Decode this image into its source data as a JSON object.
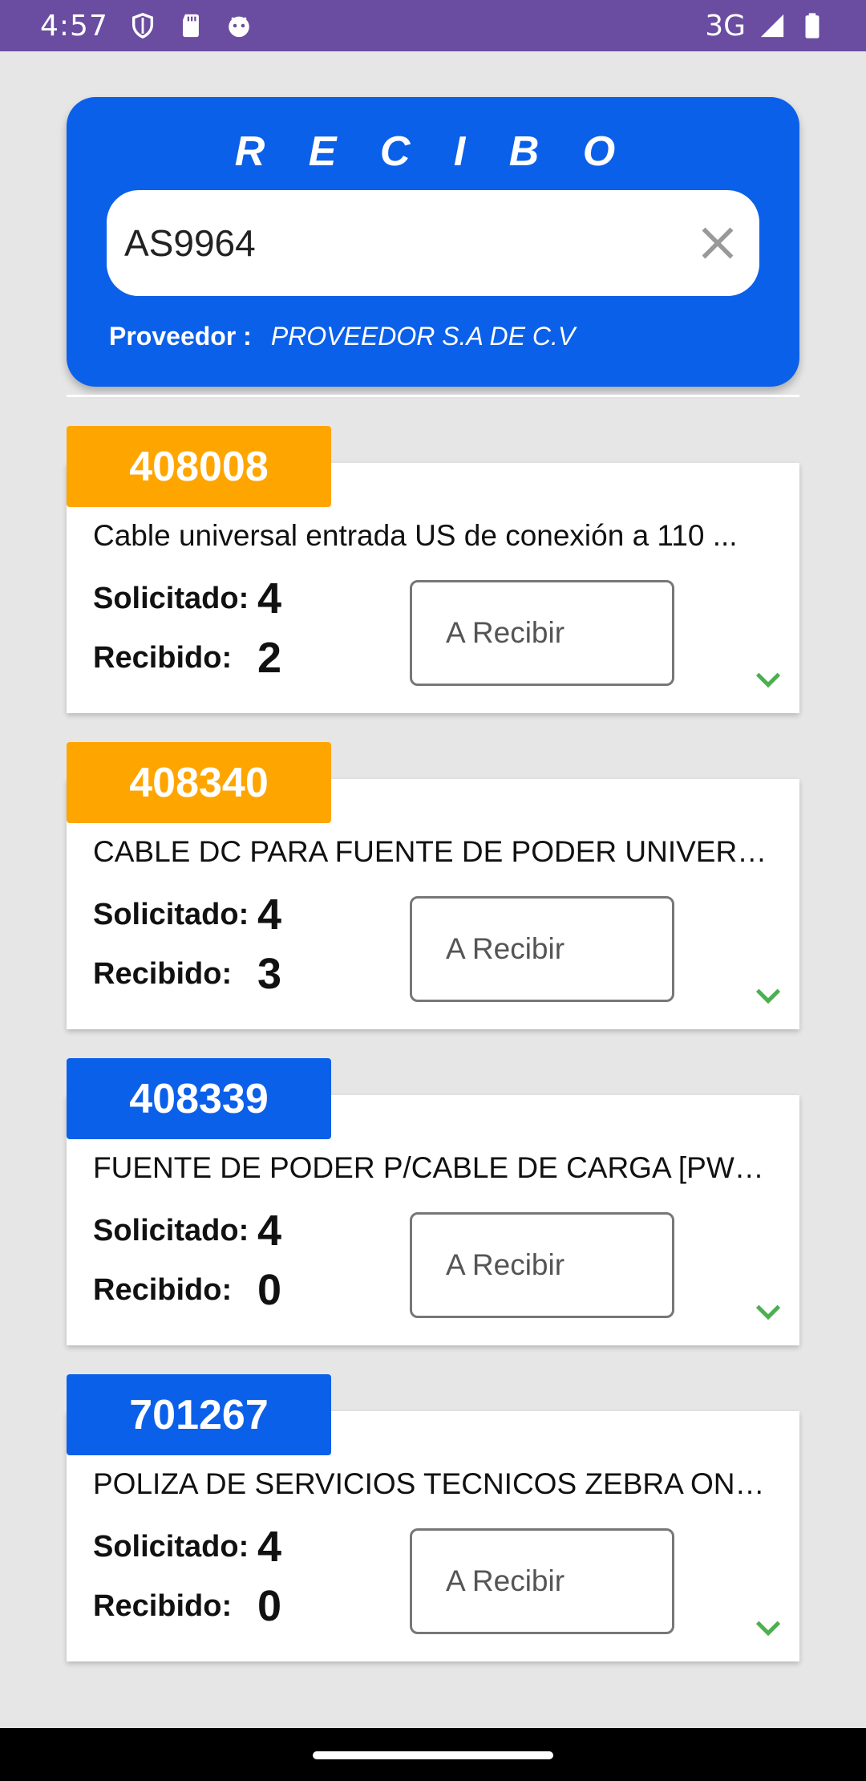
{
  "status_bar": {
    "time": "4:57",
    "network": "3G",
    "icons": [
      "shield-icon",
      "sd-card-icon",
      "android-icon",
      "signal-icon",
      "battery-icon"
    ]
  },
  "header": {
    "title": "R E C I B O",
    "search_value": "AS9964",
    "provider_label": "Proveedor :",
    "provider_value": "PROVEEDOR S.A DE C.V",
    "bg_color": "#0b60ea"
  },
  "items": [
    {
      "code": "408008",
      "code_color": "#ffa500",
      "description": "Cable universal entrada US de conexión a 110 ...",
      "requested_label": "Solicitado:",
      "requested_value": "4",
      "received_label": "Recibido:",
      "received_value": "2",
      "receive_placeholder": "A Recibir"
    },
    {
      "code": "408340",
      "code_color": "#ffa500",
      "description": "CABLE DC PARA FUENTE DE PODER UNIVERSA...",
      "requested_label": "Solicitado:",
      "requested_value": "4",
      "received_label": "Recibido:",
      "received_value": "3",
      "receive_placeholder": "A Recibir"
    },
    {
      "code": "408339",
      "code_color": "#0b60ea",
      "description": "FUENTE DE PODER P/CABLE DE CARGA [PWR-...",
      "requested_label": "Solicitado:",
      "requested_value": "4",
      "received_label": "Recibido:",
      "received_value": "0",
      "receive_placeholder": "A Recibir"
    },
    {
      "code": "701267",
      "code_color": "#0b60ea",
      "description": "POLIZA DE SERVICIOS TECNICOS ZEBRA ONE...",
      "requested_label": "Solicitado:",
      "requested_value": "4",
      "received_label": "Recibido:",
      "received_value": "0",
      "receive_placeholder": "A Recibir"
    }
  ]
}
